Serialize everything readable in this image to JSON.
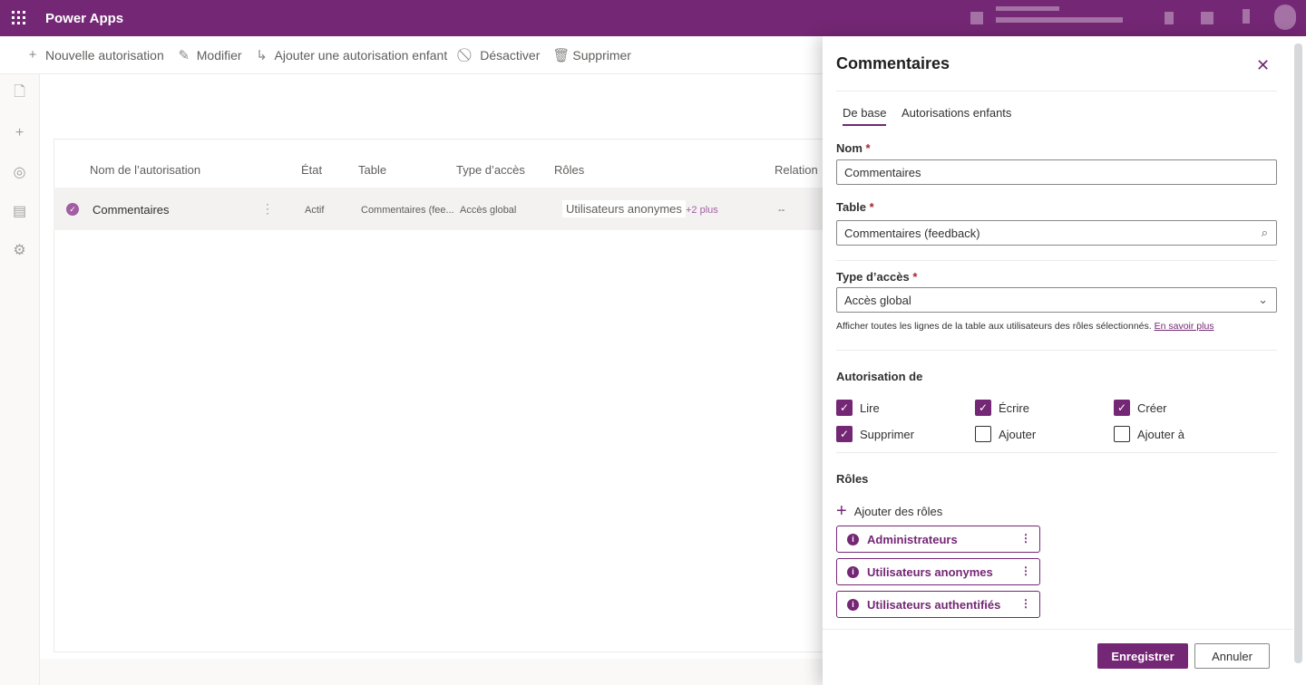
{
  "app": {
    "title": "Power Apps",
    "brand_color": "#742774"
  },
  "commands": [
    {
      "label": "Nouvelle autorisation",
      "icon": "plus-icon"
    },
    {
      "label": "Modifier",
      "icon": "pencil-icon"
    },
    {
      "label": "Ajouter une autorisation enfant",
      "icon": "child-arrow-icon"
    },
    {
      "label": "Désactiver",
      "icon": "block-icon"
    },
    {
      "label": "Supprimer",
      "icon": "trash-icon"
    }
  ],
  "rail": [
    "page-icon",
    "plus-icon",
    "palette-icon",
    "layout-icon",
    "gear-icon"
  ],
  "table": {
    "columns": [
      "Nom de l’autorisation",
      "État",
      "Table",
      "Type d’accès",
      "Rôles",
      "Relation"
    ],
    "rows": [
      {
        "name": "Commentaires",
        "state": "Actif",
        "table": "Commentaires (fee...",
        "access": "Accès global",
        "role": "Utilisateurs anonymes",
        "more": "+2 plus",
        "relation": "--"
      }
    ]
  },
  "panel": {
    "title": "Commentaires",
    "tabs": [
      "De base",
      "Autorisations enfants"
    ],
    "name_label": "Nom",
    "name_value": "Commentaires",
    "table_label": "Table",
    "table_value": "Commentaires (feedback)",
    "access_label": "Type d’accès",
    "access_value": "Accès global",
    "help_text": "Afficher toutes les lignes de la table aux utilisateurs des rôles sélectionnés.",
    "help_link": "En savoir plus",
    "perm_label": "Autorisation de",
    "permissions": [
      {
        "label": "Lire",
        "checked": true
      },
      {
        "label": "Écrire",
        "checked": true
      },
      {
        "label": "Créer",
        "checked": true
      },
      {
        "label": "Supprimer",
        "checked": true
      },
      {
        "label": "Ajouter",
        "checked": false
      },
      {
        "label": "Ajouter à",
        "checked": false
      }
    ],
    "roles_label": "Rôles",
    "add_roles": "Ajouter des rôles",
    "roles": [
      "Administrateurs",
      "Utilisateurs anonymes",
      "Utilisateurs authentifiés"
    ],
    "save": "Enregistrer",
    "cancel": "Annuler",
    "required_mark": "*"
  }
}
